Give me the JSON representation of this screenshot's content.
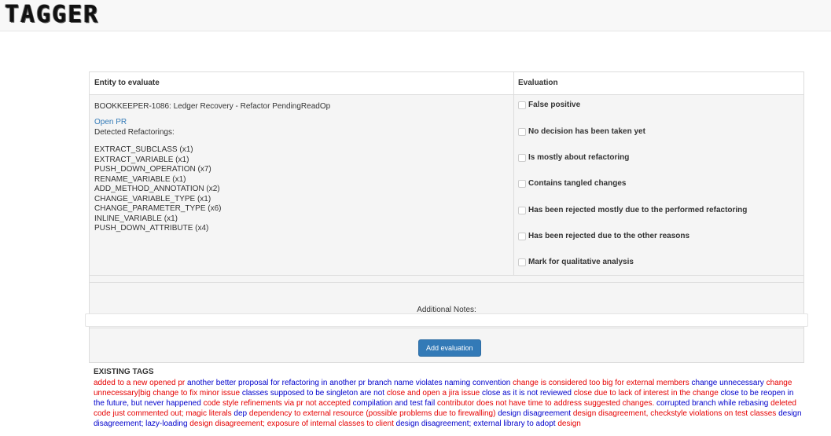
{
  "app": {
    "logo_text": "TAGGER"
  },
  "table": {
    "header_entity": "Entity to evaluate",
    "header_evaluation": "Evaluation",
    "entity_title": "BOOKKEEPER-1086: Ledger Recovery - Refactor PendingReadOp",
    "open_pr_label": "Open PR",
    "detected_label": "Detected Refactorings:",
    "refactorings": [
      "EXTRACT_SUBCLASS (x1)",
      "EXTRACT_VARIABLE (x1)",
      "PUSH_DOWN_OPERATION (x7)",
      "RENAME_VARIABLE (x1)",
      "ADD_METHOD_ANNOTATION (x2)",
      "CHANGE_VARIABLE_TYPE (x1)",
      "CHANGE_PARAMETER_TYPE (x6)",
      "INLINE_VARIABLE (x1)",
      "PUSH_DOWN_ATTRIBUTE (x4)"
    ],
    "evaluation_options": [
      "False positive",
      "No decision has been taken yet",
      "Is mostly about refactoring",
      "Contains tangled changes",
      "Has been rejected mostly due to the performed refactoring",
      "Has been rejected due to the other reasons",
      "Mark for qualitative analysis"
    ]
  },
  "notes": {
    "label": "Additional Notes:",
    "value": ""
  },
  "actions": {
    "add_evaluation_label": "Add evaluation"
  },
  "existing_tags": {
    "title": "EXISTING TAGS",
    "colors": {
      "red": "#e60000",
      "blue": "#0000cc"
    },
    "tags": [
      {
        "text": "added to a new opened pr",
        "color": "red"
      },
      {
        "text": "another better proposal for refactoring in another pr",
        "color": "blue"
      },
      {
        "text": "branch name violates naming convention",
        "color": "blue"
      },
      {
        "text": "change is considered too big for external members",
        "color": "red"
      },
      {
        "text": "change unnecessary",
        "color": "blue"
      },
      {
        "text": "change unnecessary|big change to fix minor issue",
        "color": "red"
      },
      {
        "text": "classes supposed to be singleton are not",
        "color": "blue"
      },
      {
        "text": "close and open a jira issue",
        "color": "red"
      },
      {
        "text": "close as it is not reviewed",
        "color": "blue"
      },
      {
        "text": "close due to lack of interest in the change",
        "color": "red"
      },
      {
        "text": "close to be reopen in the future, but never happened",
        "color": "blue"
      },
      {
        "text": "code style refinements via pr not accepted",
        "color": "red"
      },
      {
        "text": "compilation and test fail",
        "color": "blue"
      },
      {
        "text": "contributor does not have time to address suggested changes.",
        "color": "red"
      },
      {
        "text": "corrupted branch while rebasing",
        "color": "blue"
      },
      {
        "text": "deleted code just commented out; magic literals",
        "color": "red"
      },
      {
        "text": "dep",
        "color": "blue"
      },
      {
        "text": "dependency to external resource (possible problems due to firewalling)",
        "color": "red"
      },
      {
        "text": "design disagreement",
        "color": "blue"
      },
      {
        "text": "design disagreement,",
        "color": "red"
      },
      {
        "text": "checkstyle violations on test classes",
        "color": "red"
      },
      {
        "text": "design disagreement; lazy-loading",
        "color": "blue"
      },
      {
        "text": "design disagreement; exposure of internal classes to client",
        "color": "red"
      },
      {
        "text": "design disagreement; external library to adopt",
        "color": "blue"
      },
      {
        "text": "design",
        "color": "red"
      }
    ]
  }
}
